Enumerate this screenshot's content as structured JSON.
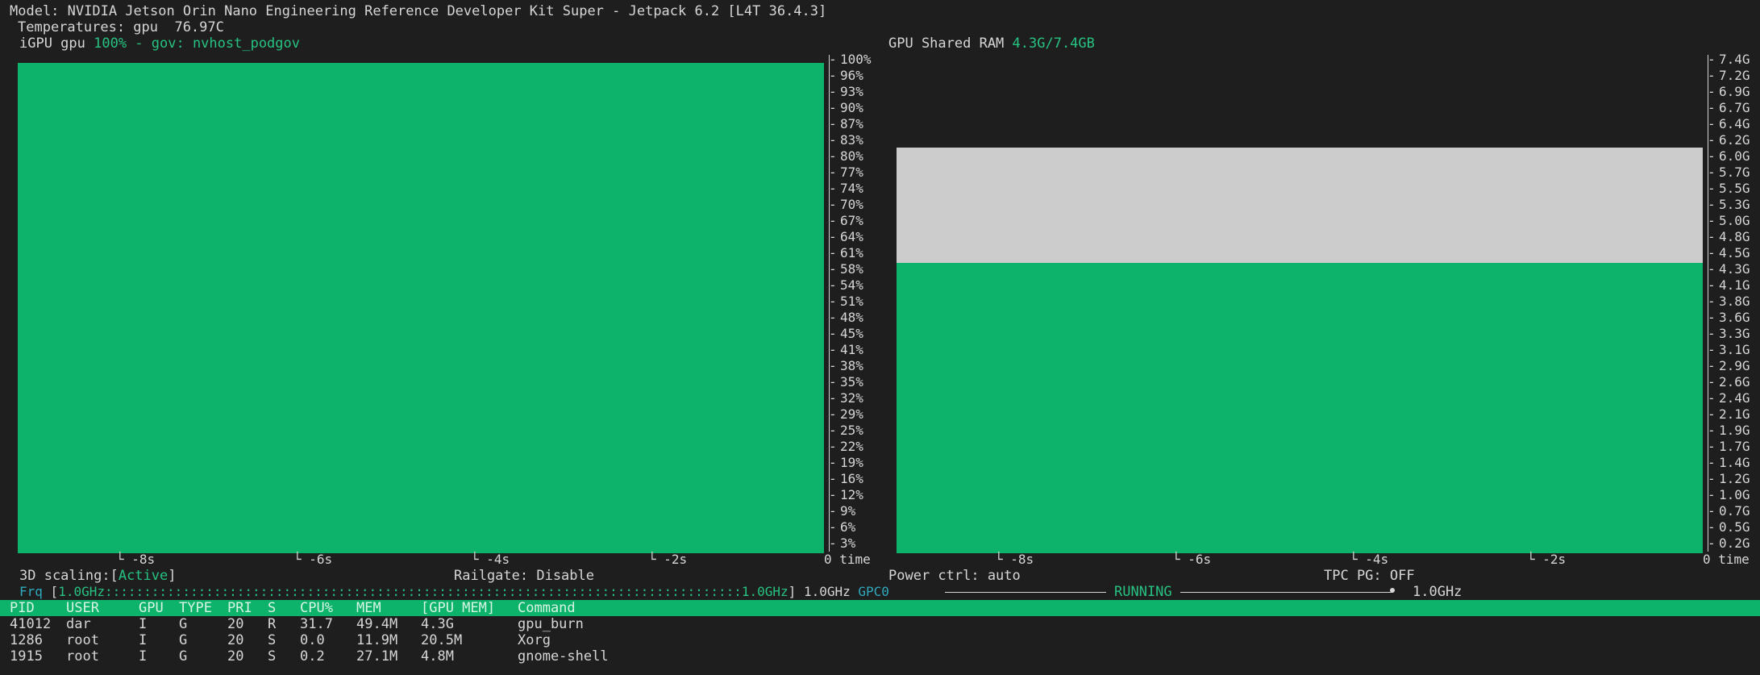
{
  "header": {
    "model_line": "Model: NVIDIA Jetson Orin Nano Engineering Reference Developer Kit Super - Jetpack 6.2 [L4T 36.4.3]",
    "temps_line": "Temperatures: gpu  76.97C"
  },
  "gpu_panel": {
    "label_prefix": "iGPU gpu ",
    "load_text": "100% - gov: nvhost_podgov",
    "yticks": [
      "100%",
      "96%",
      "93%",
      "90%",
      "87%",
      "83%",
      "80%",
      "77%",
      "74%",
      "70%",
      "67%",
      "64%",
      "61%",
      "58%",
      "54%",
      "51%",
      "48%",
      "45%",
      "41%",
      "38%",
      "35%",
      "32%",
      "29%",
      "25%",
      "22%",
      "19%",
      "16%",
      "12%",
      "9%",
      "6%",
      "3%"
    ],
    "xticks": [
      "-8s",
      "-6s",
      "-4s",
      "-2s"
    ],
    "x_end": "0 time",
    "load_fraction": 0.98
  },
  "ram_panel": {
    "label_prefix": "GPU Shared RAM ",
    "value_text": "4.3G/7.4GB",
    "yticks": [
      "7.4G",
      "7.2G",
      "6.9G",
      "6.7G",
      "6.4G",
      "6.2G",
      "6.0G",
      "5.7G",
      "5.5G",
      "5.3G",
      "5.0G",
      "4.8G",
      "4.5G",
      "4.3G",
      "4.1G",
      "3.8G",
      "3.6G",
      "3.3G",
      "3.1G",
      "2.9G",
      "2.6G",
      "2.4G",
      "2.1G",
      "1.9G",
      "1.7G",
      "1.4G",
      "1.2G",
      "1.0G",
      "0.7G",
      "0.5G",
      "0.2G"
    ],
    "xticks": [
      "-8s",
      "-6s",
      "-4s",
      "-2s"
    ],
    "x_end": "0 time",
    "used_gb": 4.3,
    "shared_total_gb": 6.0,
    "max_gb": 7.4
  },
  "status": {
    "scaling_label": "3D scaling:[",
    "scaling_value": "Active",
    "scaling_close": "]",
    "railgate": "Railgate: Disable",
    "power_ctrl": "Power ctrl: auto",
    "tpc_pg": "TPC PG: OFF"
  },
  "freq": {
    "label": "Frq",
    "bar_open": "[",
    "bar_min": "1.0GHz",
    "bar_dots": "::::::::::::::::::::::::::::::::::::::::::::::::::::::::::::::::::::::::::::::::::",
    "bar_max": "1.0GHz",
    "bar_close": "]",
    "current": "1.0GHz",
    "gpc_label": "GPC0",
    "gpc_state": "RUNNING",
    "gpc_freq": "1.0GHz"
  },
  "process_table": {
    "columns": [
      "PID",
      "USER",
      "GPU",
      "TYPE",
      "PRI",
      "S",
      "CPU%",
      "MEM",
      "[GPU MEM]",
      "Command"
    ],
    "rows": [
      [
        "41012",
        "dar",
        "I",
        "G",
        "20",
        "R",
        "31.7",
        "49.4M",
        "4.3G",
        "gpu_burn"
      ],
      [
        "1286",
        "root",
        "I",
        "G",
        "20",
        "S",
        "0.0",
        "11.9M",
        "20.5M",
        "Xorg"
      ],
      [
        "1915",
        "root",
        "I",
        "G",
        "20",
        "S",
        "0.2",
        "27.1M",
        "4.8M",
        "gnome-shell"
      ]
    ]
  },
  "colors": {
    "background": "#1e1e1e",
    "bar_green": "#0db26b",
    "shared_gray": "#cccccc",
    "accent_green": "#27c281",
    "accent_cyan": "#2ea9bd"
  }
}
